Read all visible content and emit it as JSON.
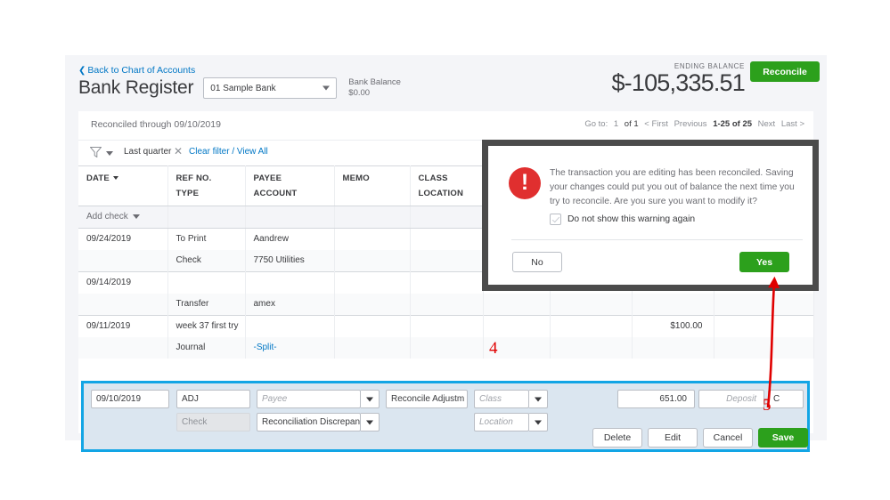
{
  "header": {
    "back_link": "Back to Chart of Accounts",
    "back_chevron": "chevron-left-icon",
    "title": "Bank Register",
    "account_selected": "01 Sample Bank",
    "bank_balance_label": "Bank Balance",
    "bank_balance_value": "$0.00",
    "ending_balance_label": "ENDING BALANCE",
    "ending_balance_value": "$-105,335.51",
    "reconcile_button": "Reconcile",
    "accent_green": "#2ca01c",
    "link_blue": "#0077c5"
  },
  "register": {
    "reconciled_through": "Reconciled through 09/10/2019",
    "pager": {
      "goto_label": "Go to:",
      "page_current": "1",
      "page_of": "of 1",
      "first": "< First",
      "previous": "Previous",
      "range": "1-25 of 25",
      "next": "Next",
      "last": "Last >"
    },
    "filter": {
      "funnel_icon": "filter-funnel-icon",
      "chip_label": "Last quarter",
      "chip_remove_icon": "close-x-icon",
      "clear_link": "Clear filter / View All"
    },
    "columns": [
      {
        "top": "DATE",
        "bottom": "",
        "sortable": true
      },
      {
        "top": "REF NO.",
        "bottom": "TYPE",
        "sortable": false
      },
      {
        "top": "PAYEE",
        "bottom": "ACCOUNT",
        "sortable": false
      },
      {
        "top": "MEMO",
        "bottom": "",
        "sortable": false
      },
      {
        "top": "CLASS",
        "bottom": "LOCATION",
        "sortable": false
      },
      {
        "top": "",
        "bottom": "",
        "sortable": false
      },
      {
        "top": "",
        "bottom": "",
        "sortable": false
      },
      {
        "top": "",
        "bottom": "",
        "sortable": false
      },
      {
        "top": "",
        "bottom": "",
        "sortable": false
      }
    ],
    "add_check": "Add check",
    "rows": [
      {
        "date": "09/24/2019",
        "ref": "To Print",
        "payee": "Aandrew",
        "memo": "",
        "class": "",
        "payment": "",
        "deposit": "",
        "balance": ""
      },
      {
        "date": "",
        "ref": "Check",
        "payee": "7750 Utilities",
        "memo": "",
        "class": "",
        "payment": "",
        "deposit": "",
        "balance": ""
      },
      {
        "date": "09/14/2019",
        "ref": "",
        "payee": "",
        "memo": "",
        "class": "",
        "payment": "",
        "deposit": "",
        "balance": ""
      },
      {
        "date": "",
        "ref": "Transfer",
        "payee": "amex",
        "memo": "",
        "class": "",
        "payment": "",
        "deposit": "",
        "balance": ""
      },
      {
        "date": "09/11/2019",
        "ref": "week 37 first try",
        "payee": "",
        "memo": "",
        "class": "",
        "payment": "",
        "deposit": "$100.00",
        "balance": ""
      },
      {
        "date": "",
        "ref": "Journal",
        "payee": "-Split-",
        "memo": "",
        "class": "",
        "payment": "",
        "deposit": "",
        "balance": ""
      }
    ]
  },
  "edit_row": {
    "date_value": "09/10/2019",
    "ref_value": "ADJ",
    "type_value": "Check",
    "payee_placeholder": "Payee",
    "account_value": "Reconciliation Discrepanc",
    "memo_value": "Reconcile Adjustm",
    "class_placeholder": "Class",
    "location_placeholder": "Location",
    "payment_value": "651.00",
    "deposit_placeholder": "Deposit",
    "reconcile_status": "C",
    "buttons": {
      "delete": "Delete",
      "edit": "Edit",
      "cancel": "Cancel",
      "save": "Save"
    }
  },
  "modal": {
    "icon": "warning-exclamation-icon",
    "message": "The transaction you are editing has been reconciled. Saving your changes could put you out of balance the next time you try to reconcile. Are you sure you want to modify it?",
    "checkbox_label": "Do not show this warning again",
    "checkbox_checked": true,
    "no_button": "No",
    "yes_button": "Yes",
    "border_color": "#4b4b4b",
    "icon_color": "#e02f2f"
  },
  "annotations": {
    "color": "#e00000",
    "marker_4": "4",
    "marker_5": "5"
  }
}
